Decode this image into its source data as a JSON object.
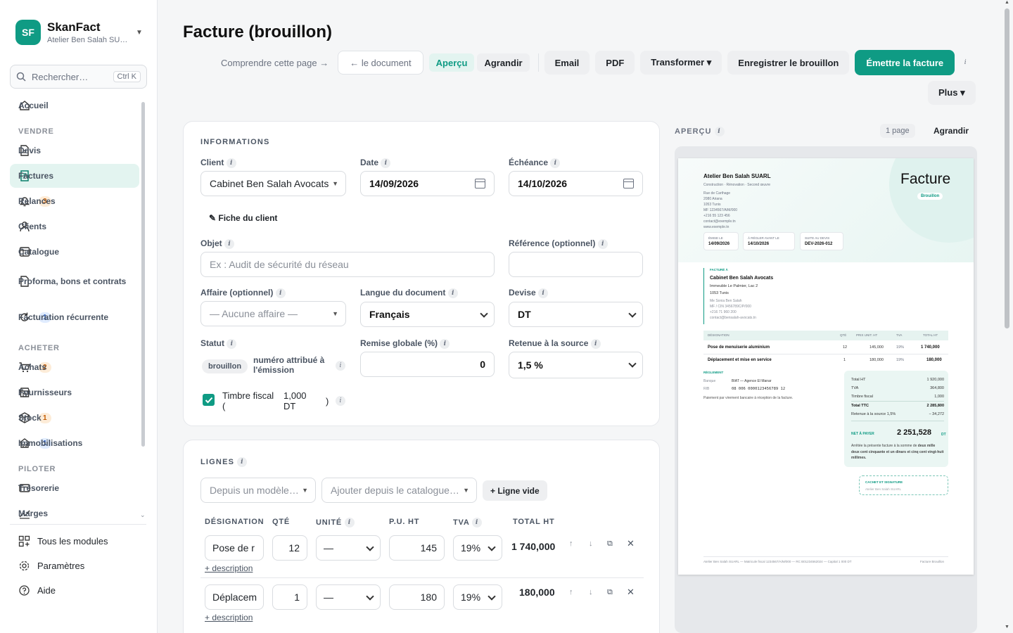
{
  "brand": {
    "initials": "SF",
    "name": "SkanFact",
    "subtitle": "Atelier Ben Salah SU…"
  },
  "search": {
    "placeholder": "Rechercher…",
    "shortcut": "Ctrl K"
  },
  "nav": {
    "home": "Accueil",
    "sections": {
      "sell": "VENDRE",
      "buy": "ACHETER",
      "steer": "PILOTER"
    },
    "items": [
      {
        "label": "Devis"
      },
      {
        "label": "Factures"
      },
      {
        "label": "Relances",
        "badge": "3"
      },
      {
        "label": "Clients"
      },
      {
        "label": "Catalogue"
      },
      {
        "label": "Proforma, bons et contrats"
      },
      {
        "label": "Facturation récurrente",
        "badge": "1"
      },
      {
        "label": "Achats",
        "badge": "2"
      },
      {
        "label": "Fournisseurs"
      },
      {
        "label": "Stock",
        "badge": "1"
      },
      {
        "label": "Immobilisations",
        "badge": "1"
      },
      {
        "label": "Trésorerie"
      },
      {
        "label": "Marges"
      }
    ],
    "bottom": [
      "Tous les modules",
      "Paramètres",
      "Aide"
    ]
  },
  "page": {
    "title": "Facture (brouillon)"
  },
  "toolbar": {
    "understand": "Comprendre cette page →",
    "document": "← le document",
    "preview": "Aperçu",
    "enlarge": "Agrandir",
    "email": "Email",
    "pdf": "PDF",
    "transform": "Transformer ▾",
    "save": "Enregistrer le brouillon",
    "issue": "Émettre la facture",
    "more": "Plus ▾"
  },
  "info": {
    "title": "INFORMATIONS",
    "client_label": "Client",
    "client_value": "Cabinet Ben Salah Avocats",
    "date_label": "Date",
    "date_value": "14/09/2026",
    "due_label": "Échéance",
    "due_value": "14/10/2026",
    "client_sheet": "✎ Fiche du client",
    "object_label": "Objet",
    "object_placeholder": "Ex : Audit de sécurité du réseau",
    "ref_label": "Référence (optionnel)",
    "affair_label": "Affaire (optionnel)",
    "affair_value": "— Aucune affaire —",
    "lang_label": "Langue du document",
    "lang_value": "Français",
    "currency_label": "Devise",
    "currency_value": "DT",
    "status_label": "Statut",
    "status_chip": "brouillon",
    "status_note": "numéro attribué à l'émission",
    "discount_label": "Remise globale (%)",
    "discount_value": "0",
    "withholding_label": "Retenue à la source",
    "withholding_value": "1,5 %",
    "stamp_label_a": "Timbre fiscal",
    "stamp_label_b": "(",
    "stamp_amount": "1,000 DT",
    "stamp_close": ")"
  },
  "lines": {
    "title": "LIGNES",
    "from_model": "Depuis un modèle…",
    "from_catalog": "Ajouter depuis le catalogue…",
    "empty_line": "+ Ligne vide",
    "headers": [
      "DÉSIGNATION",
      "QTÉ",
      "UNITÉ",
      "P.U. HT",
      "TVA",
      "TOTAL HT"
    ],
    "rows": [
      {
        "designation": "Pose de r",
        "qty": "12",
        "unit": "—",
        "price": "145",
        "vat": "19%",
        "total": "1 740,000",
        "desc": "+ description"
      },
      {
        "designation": "Déplacem",
        "qty": "1",
        "unit": "—",
        "price": "180",
        "vat": "19%",
        "total": "180,000",
        "desc": "+ description"
      }
    ]
  },
  "preview": {
    "title": "APERÇU",
    "pages": "1 page",
    "enlarge": "Agrandir",
    "doc": {
      "company": "Atelier Ben Salah SUARL",
      "tagline": "Construction · Rénovation · Second œuvre",
      "address": [
        "Rue de Carthage",
        "2080 Ariana",
        "1053 Tunis",
        "MF 1234567/A/M/000",
        "+216 55 123 456",
        "contact@exemple.tn",
        "www.exemple.tn"
      ],
      "doc_title": "Facture",
      "doc_status": "Brouillon",
      "boxes": [
        {
          "k": "ÉMISE LE",
          "v": "14/09/2026"
        },
        {
          "k": "À RÉGLER AVANT LE",
          "v": "14/10/2026"
        },
        {
          "k": "SUITE AU DEVIS",
          "v": "DEV-2026-012"
        }
      ],
      "billed_to": "FACTURÉ À",
      "client_name": "Cabinet Ben Salah Avocats",
      "client_lines": [
        "Immeuble Le Palmier, Lac 2",
        "1053 Tunis"
      ],
      "client_contact": [
        "Me Sonia Ben Salah",
        "MF / CIN 3456789C/P/000",
        "+216 71 960 200",
        "contact@bensalah-avocats.tn"
      ],
      "table_headers": [
        "DÉSIGNATION",
        "QTÉ",
        "PRIX UNIT. HT",
        "TVA",
        "TOTAL HT"
      ],
      "table_rows": [
        [
          "Pose de menuiserie aluminium",
          "12",
          "145,000",
          "19%",
          "1 740,000"
        ],
        [
          "Déplacement et mise en service",
          "1",
          "180,000",
          "19%",
          "180,000"
        ]
      ],
      "payment_title": "RÈGLEMENT",
      "bank_k": "Banque",
      "bank_v": "BIAT — Agence El Manar",
      "rib_k": "RIB",
      "rib_v": "08 006 0000123456789 12",
      "payment_note": "Paiement par virement bancaire à réception de la facture.",
      "totals": [
        [
          "Total HT",
          "1 920,000"
        ],
        [
          "TVA",
          "364,800"
        ],
        [
          "Timbre fiscal",
          "1,000"
        ],
        [
          "Total TTC",
          "2 285,800"
        ],
        [
          "Retenue à la source 1,5%",
          "− 34,272"
        ]
      ],
      "net_label": "NET À PAYER",
      "net_value": "2 251,528",
      "net_unit": "DT",
      "amount_words_a": "Arrêtée la présente facture à la somme de",
      "amount_words_b": "deux mille deux cent cinquante et un dinars et cinq cent vingt-huit millimes.",
      "stamp_title": "CACHET ET SIGNATURE",
      "stamp_name": "Atelier Ben Salah SUARL",
      "footer_left": "Atelier Ben Salah SUARL — Matricule fiscal 1234567/A/M/000 — RC B01234562024 — Capital 1 000 DT",
      "footer_right": "Facture Brouillon"
    }
  },
  "colors": {
    "accent": "#0f9b84",
    "accent_light": "#e3f4f0"
  }
}
